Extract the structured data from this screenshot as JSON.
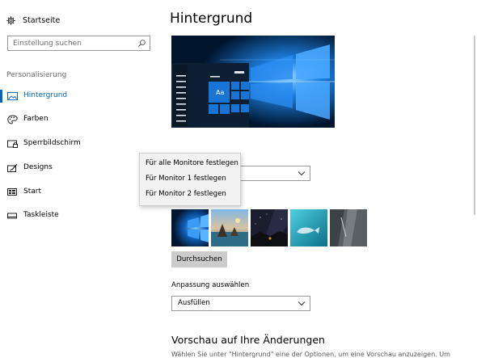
{
  "sidebar": {
    "home": {
      "label": "Startseite",
      "icon": "gear-icon"
    },
    "search": {
      "placeholder": "Einstellung suchen",
      "icon": "search-icon"
    },
    "section_header": "Personalisierung",
    "items": [
      {
        "label": "Hintergrund",
        "icon": "picture-icon",
        "active": true
      },
      {
        "label": "Farben",
        "icon": "palette-icon",
        "active": false
      },
      {
        "label": "Sperrbildschirm",
        "icon": "lock-screen-icon",
        "active": false
      },
      {
        "label": "Designs",
        "icon": "brush-icon",
        "active": false
      },
      {
        "label": "Start",
        "icon": "start-grid-icon",
        "active": false
      },
      {
        "label": "Taskleiste",
        "icon": "taskbar-icon",
        "active": false
      }
    ]
  },
  "main": {
    "title": "Hintergrund",
    "preview": {
      "tile_label": "Aa"
    },
    "context_menu": {
      "items": [
        "Für alle Monitore festlegen",
        "Für Monitor 1 festlegen",
        "Für Monitor 2 festlegen"
      ]
    },
    "browse_button": "Durchsuchen",
    "fit": {
      "label": "Anpassung auswählen",
      "value": "Ausfüllen"
    },
    "preview_heading": "Vorschau auf Ihre Änderungen",
    "description": "Wählen Sie unter \"Hintergrund\" eine der Optionen, um eine Vorschau anzuzeigen. Um"
  },
  "colors": {
    "accent": "#0067c0",
    "preview_background": "#00142c",
    "menu_background": "#f2f2f2",
    "button_background": "#cccccc"
  }
}
